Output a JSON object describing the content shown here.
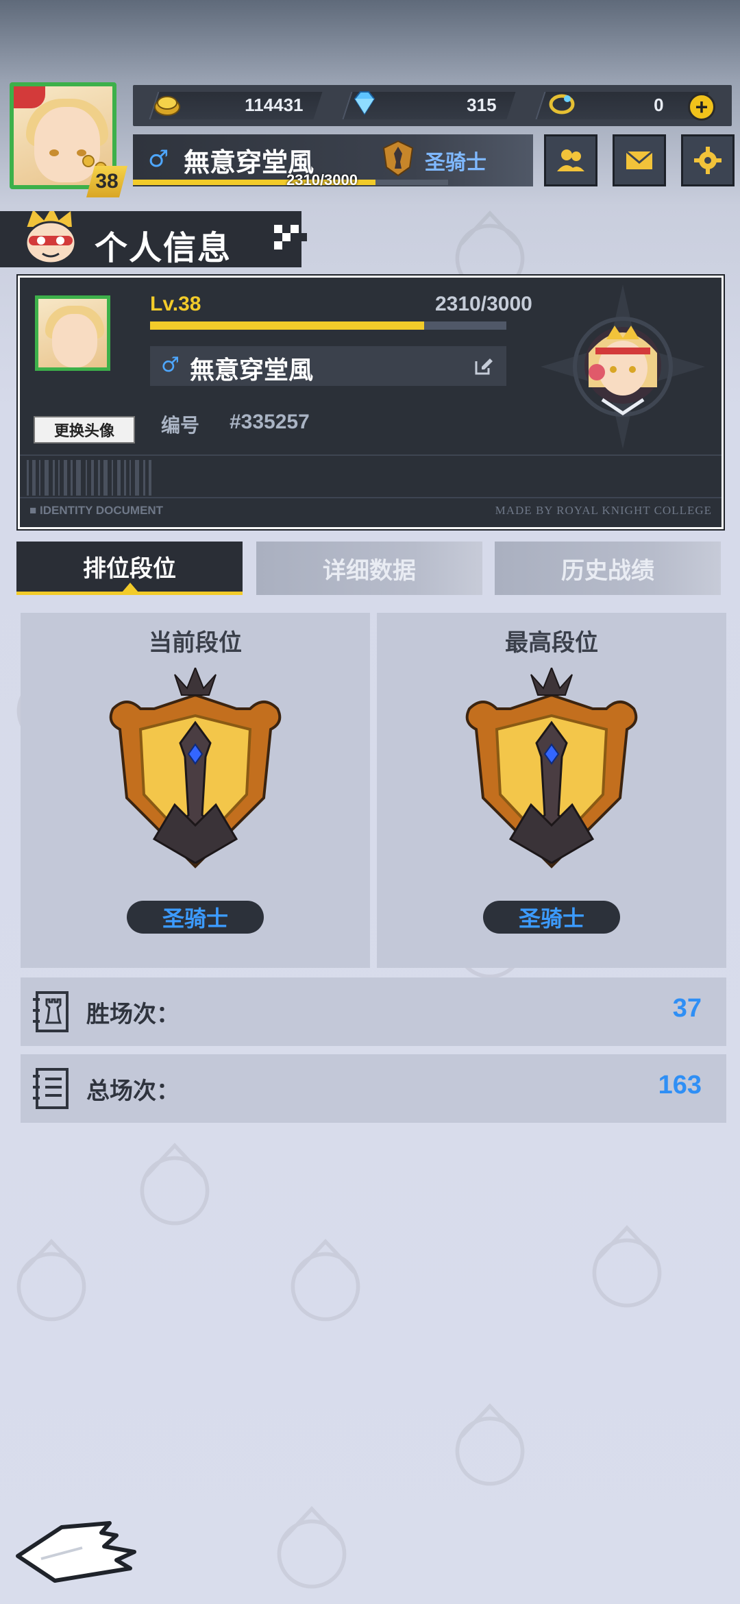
{
  "currency": {
    "gold": "114431",
    "diamond": "315",
    "ticket": "0"
  },
  "player": {
    "level": "38",
    "level_label": "Lv.38",
    "name": "無意穿堂風",
    "gender_symbol": "♂",
    "xp_text": "2310/3000",
    "xp_fraction": 0.77,
    "rank": "圣骑士",
    "id_label": "编号",
    "id_value": "#335257"
  },
  "section": {
    "title": "个人信息"
  },
  "id_card": {
    "change_avatar": "更换头像",
    "doc_left": "■ IDENTITY DOCUMENT",
    "doc_right": "MADE BY ROYAL KNIGHT COLLEGE"
  },
  "tabs": [
    {
      "label": "排位段位",
      "active": true
    },
    {
      "label": "详细数据",
      "active": false
    },
    {
      "label": "历史战绩",
      "active": false
    }
  ],
  "rank_panels": {
    "current": {
      "title": "当前段位",
      "rank": "圣骑士"
    },
    "highest": {
      "title": "最高段位",
      "rank": "圣骑士"
    }
  },
  "stats": {
    "wins": {
      "label": "胜场次：",
      "value": "37"
    },
    "total": {
      "label": "总场次：",
      "value": "163"
    }
  },
  "colors": {
    "accent_yellow": "#f2cb2a",
    "rank_blue": "#3c9bff",
    "frame_green": "#3db04a",
    "dark_panel": "#2a2e36"
  }
}
